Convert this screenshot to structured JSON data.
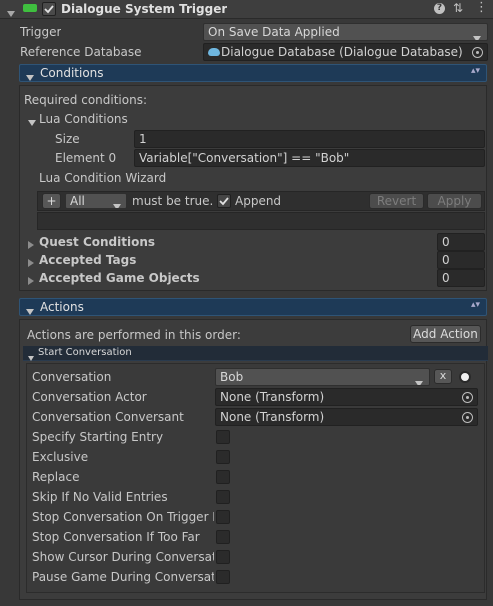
{
  "component": {
    "title": "Dialogue System Trigger",
    "enabled": true
  },
  "trigger": {
    "label": "Trigger",
    "value": "On Save Data Applied"
  },
  "reference_database": {
    "label": "Reference Database",
    "value": "Dialogue Database (Dialogue Database)"
  },
  "conditions": {
    "header": "Conditions",
    "required_label": "Required conditions:",
    "lua_header": "Lua Conditions",
    "size_label": "Size",
    "size_value": "1",
    "element0_label": "Element 0",
    "element0_value": "Variable[\"Conversation\"] == \"Bob\"",
    "wizard_label": "Lua Condition Wizard",
    "wizard_plus": "+",
    "wizard_mode": "All",
    "wizard_must": "must be true.",
    "wizard_append": "Append",
    "wizard_append_checked": true,
    "revert_label": "Revert",
    "apply_label": "Apply",
    "quest_label": "Quest Conditions",
    "quest_value": "0",
    "tags_label": "Accepted Tags",
    "tags_value": "0",
    "gameobjects_label": "Accepted Game Objects",
    "gameobjects_value": "0"
  },
  "actions": {
    "header": "Actions",
    "order_label": "Actions are performed in this order:",
    "add_action": "Add Action",
    "start_conv_header": "Start Conversation",
    "conversation_label": "Conversation",
    "conversation_value": "Bob",
    "clear_label": "x",
    "actor_label": "Conversation Actor",
    "actor_value": "None (Transform)",
    "conversant_label": "Conversation Conversant",
    "conversant_value": "None (Transform)",
    "toggles": [
      {
        "label": "Specify Starting Entry",
        "checked": false
      },
      {
        "label": "Exclusive",
        "checked": false
      },
      {
        "label": "Replace",
        "checked": false
      },
      {
        "label": "Skip If No Valid Entries",
        "checked": false
      },
      {
        "label": "Stop Conversation On Trigger Ex",
        "checked": false
      },
      {
        "label": "Stop Conversation If Too Far",
        "checked": false
      },
      {
        "label": "Show Cursor During Conversatic",
        "checked": false
      },
      {
        "label": "Pause Game During Conversatio",
        "checked": false
      }
    ]
  },
  "colors": {
    "section_bar": "#1e3a57",
    "enabled_icon": "#3fbf3f",
    "panel_bg": "#383838"
  }
}
